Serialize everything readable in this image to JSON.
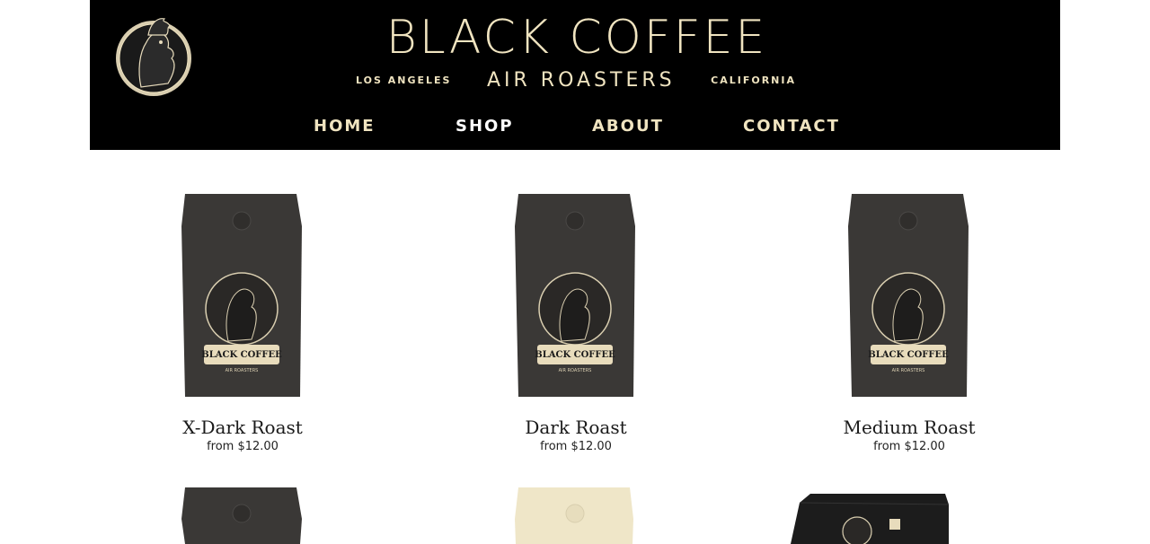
{
  "header": {
    "brand_title": "BLACK COFFEE",
    "brand_left": "LOS ANGELES",
    "brand_middle": "AIR ROASTERS",
    "brand_right": "CALIFORNIA",
    "bag_label": "BLACK COFFEE",
    "bag_sublabel": "AIR ROASTERS"
  },
  "nav": {
    "items": [
      {
        "label": "HOME"
      },
      {
        "label": "SHOP"
      },
      {
        "label": "ABOUT"
      },
      {
        "label": "CONTACT"
      }
    ],
    "active": "SHOP"
  },
  "products": [
    {
      "name": "X-Dark Roast",
      "price": "from $12.00"
    },
    {
      "name": "Dark Roast",
      "price": "from $12.00"
    },
    {
      "name": "Medium Roast",
      "price": "from $12.00"
    }
  ],
  "colors": {
    "header_bg": "#000000",
    "brand_gold": "#f0e4c0",
    "bag_dark": "#3a3836",
    "bag_cream": "#efe6c8"
  }
}
